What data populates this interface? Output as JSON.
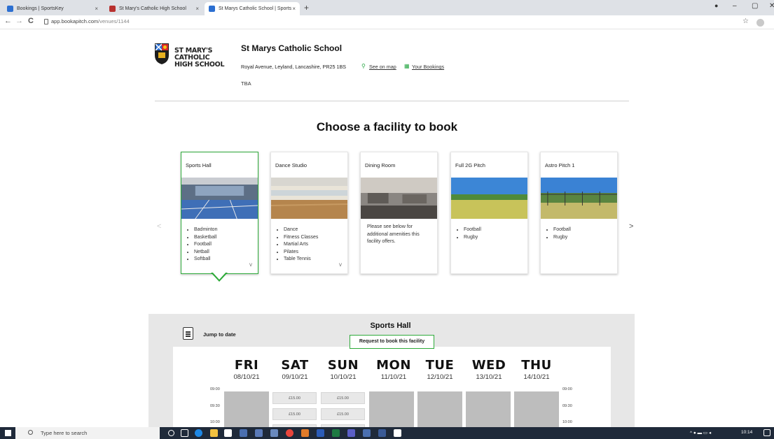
{
  "browser": {
    "tabs": [
      {
        "label": "Bookings | SportsKey",
        "close": "×"
      },
      {
        "label": "St Mary's Catholic High School",
        "close": "×"
      },
      {
        "label": "St Marys Catholic School | Sports",
        "close": "×"
      }
    ],
    "new_tab": "+",
    "url_host": "app.bookapitch.com",
    "url_path": "/venues/1144",
    "back": "←",
    "forward": "→",
    "reload": "C",
    "star": "☆"
  },
  "header": {
    "school_logo_text": "ST MARY'S CATHOLIC HIGH SCHOOL",
    "venue_title": "St Marys Catholic School",
    "address": "Royal Avenue, Leyland, Lancashire, PR25 1BS",
    "see_on_map": "See on map",
    "your_bookings": "Your Bookings",
    "tba": "TBA"
  },
  "heading": "Choose a facility to book",
  "carousel": {
    "prev": "<",
    "next": ">"
  },
  "facilities": [
    {
      "name": "Sports Hall",
      "items": [
        "Badminton",
        "Basketball",
        "Football",
        "Netball",
        "Softball"
      ],
      "expand": "v"
    },
    {
      "name": "Dance Studio",
      "items": [
        "Dance",
        "Fitness Classes",
        "Martial Arts",
        "Pilates",
        "Table Tennis"
      ],
      "expand": "v"
    },
    {
      "name": "Dining Room",
      "description": "Please see below for additional amenities this facility offers."
    },
    {
      "name": "Full 2G Pitch",
      "items": [
        "Football",
        "Rugby"
      ]
    },
    {
      "name": "Astro Pitch 1",
      "items": [
        "Football",
        "Rugby"
      ]
    }
  ],
  "booking": {
    "title": "Sports Hall",
    "jump_to_date": "Jump to date",
    "request_button": "Request to book this facility",
    "days": [
      {
        "day": "FRI",
        "date": "08/10/21"
      },
      {
        "day": "SAT",
        "date": "09/10/21"
      },
      {
        "day": "SUN",
        "date": "10/10/21"
      },
      {
        "day": "MON",
        "date": "11/10/21"
      },
      {
        "day": "TUE",
        "date": "12/10/21"
      },
      {
        "day": "WED",
        "date": "13/10/21"
      },
      {
        "day": "THU",
        "date": "14/10/21"
      }
    ],
    "times": [
      "09:00",
      "09:30",
      "10:00"
    ],
    "price": "£15.00"
  },
  "taskbar": {
    "search_placeholder": "Type here to search",
    "time": "10:14"
  }
}
